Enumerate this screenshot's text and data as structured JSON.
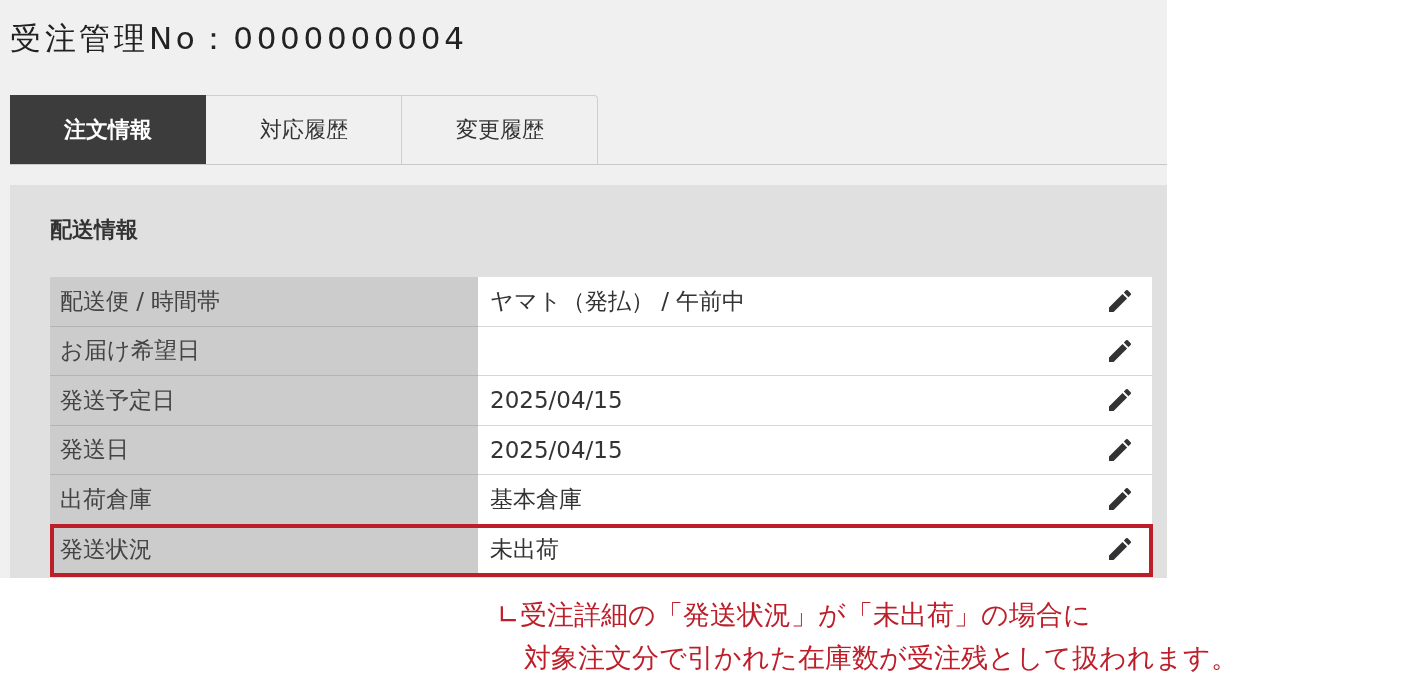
{
  "title": "受注管理No：0000000004",
  "tabs": [
    {
      "label": "注文情報",
      "selected": true
    },
    {
      "label": "対応履歴",
      "selected": false
    },
    {
      "label": "変更履歴",
      "selected": false
    }
  ],
  "section": {
    "heading": "配送情報",
    "rows": [
      {
        "label": "配送便 / 時間帯",
        "value": "ヤマト（発払） / 午前中",
        "highlighted": false
      },
      {
        "label": "お届け希望日",
        "highlighted": false
      },
      {
        "label": "発送予定日",
        "value": "2025/04/15",
        "highlighted": false
      },
      {
        "label": "発送日",
        "value": "2025/04/15",
        "highlighted": false
      },
      {
        "label": "出荷倉庫",
        "value": "基本倉庫",
        "highlighted": false
      },
      {
        "label": "発送状況",
        "value": "未出荷",
        "highlighted": true
      }
    ]
  },
  "note": {
    "lines": [
      "∟受注詳細の「発送状況」が「未出荷」の場合に",
      "対象注文分で引かれた在庫数が受注残として扱われます。"
    ]
  }
}
